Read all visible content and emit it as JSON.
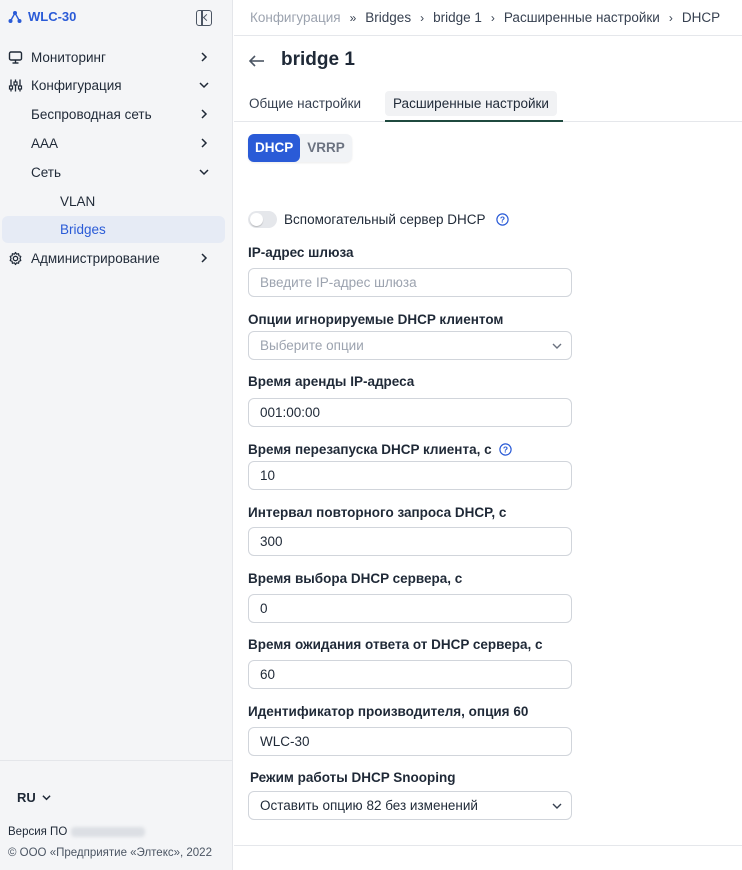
{
  "app": {
    "title": "WLC-30",
    "brand_color": "#2a5bd7"
  },
  "sidebar": {
    "items": [
      {
        "label": "Мониторинг",
        "icon": "monitor-icon",
        "expanded": false
      },
      {
        "label": "Конфигурация",
        "icon": "sliders-icon",
        "expanded": true
      },
      {
        "label": "Беспроводная сеть",
        "expanded": false
      },
      {
        "label": "AAA",
        "expanded": false
      },
      {
        "label": "Сеть",
        "expanded": true
      },
      {
        "label": "VLAN"
      },
      {
        "label": "Bridges",
        "active": true
      },
      {
        "label": "Администрирование",
        "icon": "gear-icon",
        "expanded": false
      }
    ],
    "language": "RU",
    "version_label": "Версия ПО",
    "copyright": "© ООО «Предприятие «Элтекс», 2022"
  },
  "breadcrumb": [
    "Конфигурация",
    "Bridges",
    "bridge 1",
    "Расширенные настройки",
    "DHCP"
  ],
  "page": {
    "title": "bridge 1",
    "tabs": [
      "Общие настройки",
      "Расширенные настройки"
    ],
    "active_tab": "Расширенные настройки",
    "segments": [
      "DHCP",
      "VRRP"
    ],
    "active_segment": "DHCP"
  },
  "form": {
    "relay_toggle_label": "Вспомогательный сервер DHCP",
    "relay_enabled": false,
    "gateway_label": "IP-адрес шлюза",
    "gateway_placeholder": "Введите IP-адрес шлюза",
    "ignored_options_label": "Опции игнорируемые DHCP клиентом",
    "ignored_options_placeholder": "Выберите опции",
    "lease_label": "Время аренды IP-адреса",
    "lease_value": "001:00:00",
    "restart_label": "Время перезапуска DHCP клиента, с",
    "restart_value": "10",
    "retry_label": "Интервал повторного запроса DHCP, с",
    "retry_value": "300",
    "select_label": "Время выбора DHCP сервера, с",
    "select_value": "0",
    "timeout_label": "Время ожидания ответа от DHCP сервера, с",
    "timeout_value": "60",
    "vendor_label": "Идентификатор производителя, опция 60",
    "vendor_value": "WLC-30",
    "snooping_label": "Режим работы DHCP Snooping",
    "snooping_value": "Оставить опцию 82 без изменений"
  }
}
